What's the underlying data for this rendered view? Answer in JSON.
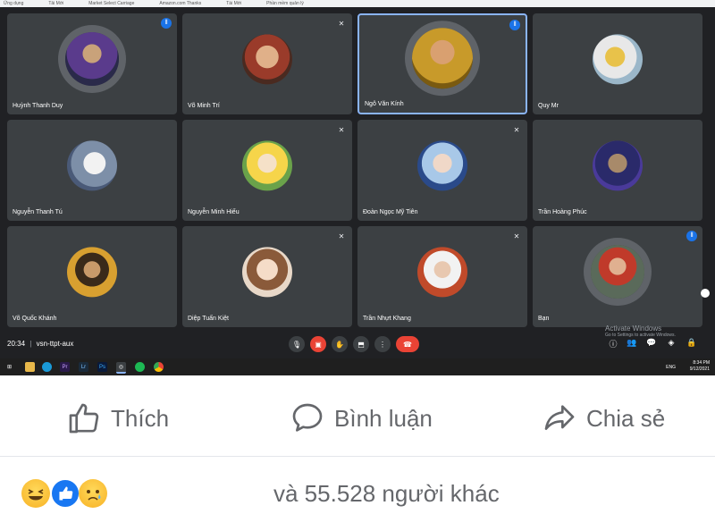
{
  "bookmarks": [
    "Ứng dụng",
    "Tải Mới",
    "Market Select Carriage",
    "Amazon.com Thanks",
    "Tài Mới",
    "Phần mềm quản lý"
  ],
  "participants": [
    {
      "name": "Huỳnh Thanh Duy",
      "status": "voice"
    },
    {
      "name": "Võ Minh Trí",
      "status": "muted"
    },
    {
      "name": "Ngô Văn Kính",
      "status": "voice"
    },
    {
      "name": "Quy Mr",
      "status": ""
    },
    {
      "name": "Nguyễn Thanh Tú",
      "status": ""
    },
    {
      "name": "Nguyễn Minh Hiếu",
      "status": "muted"
    },
    {
      "name": "Đoàn Ngọc Mỹ Tiên",
      "status": "muted"
    },
    {
      "name": "Trần Hoàng Phúc",
      "status": ""
    },
    {
      "name": "Võ Quốc Khánh",
      "status": ""
    },
    {
      "name": "Diệp Tuấn Kiệt",
      "status": "muted"
    },
    {
      "name": "Trần Nhựt Khang",
      "status": "muted"
    },
    {
      "name": "Bạn",
      "status": "voice"
    }
  ],
  "meeting": {
    "time": "20:34",
    "separator": "|",
    "code": "vsn-ttpt-aux"
  },
  "windows_watermark": {
    "line1": "Activate Windows",
    "line2": "Go to Settings to activate Windows."
  },
  "taskbar": {
    "time": "8:34 PM",
    "date": "9/12/2021",
    "lang": "ENG"
  },
  "icons": {
    "voice": "voice-activity-icon",
    "muted": "mic-off-icon"
  },
  "actions": {
    "like": "Thích",
    "comment": "Bình luận",
    "share": "Chia sẻ"
  },
  "reactions_text": "và 55.528 người khác",
  "colors": {
    "meet_bg": "#202124",
    "tile_bg": "#3c4043",
    "active_border": "#8ab4f8",
    "end_call": "#ea4335",
    "fb_gray": "#65676b"
  }
}
